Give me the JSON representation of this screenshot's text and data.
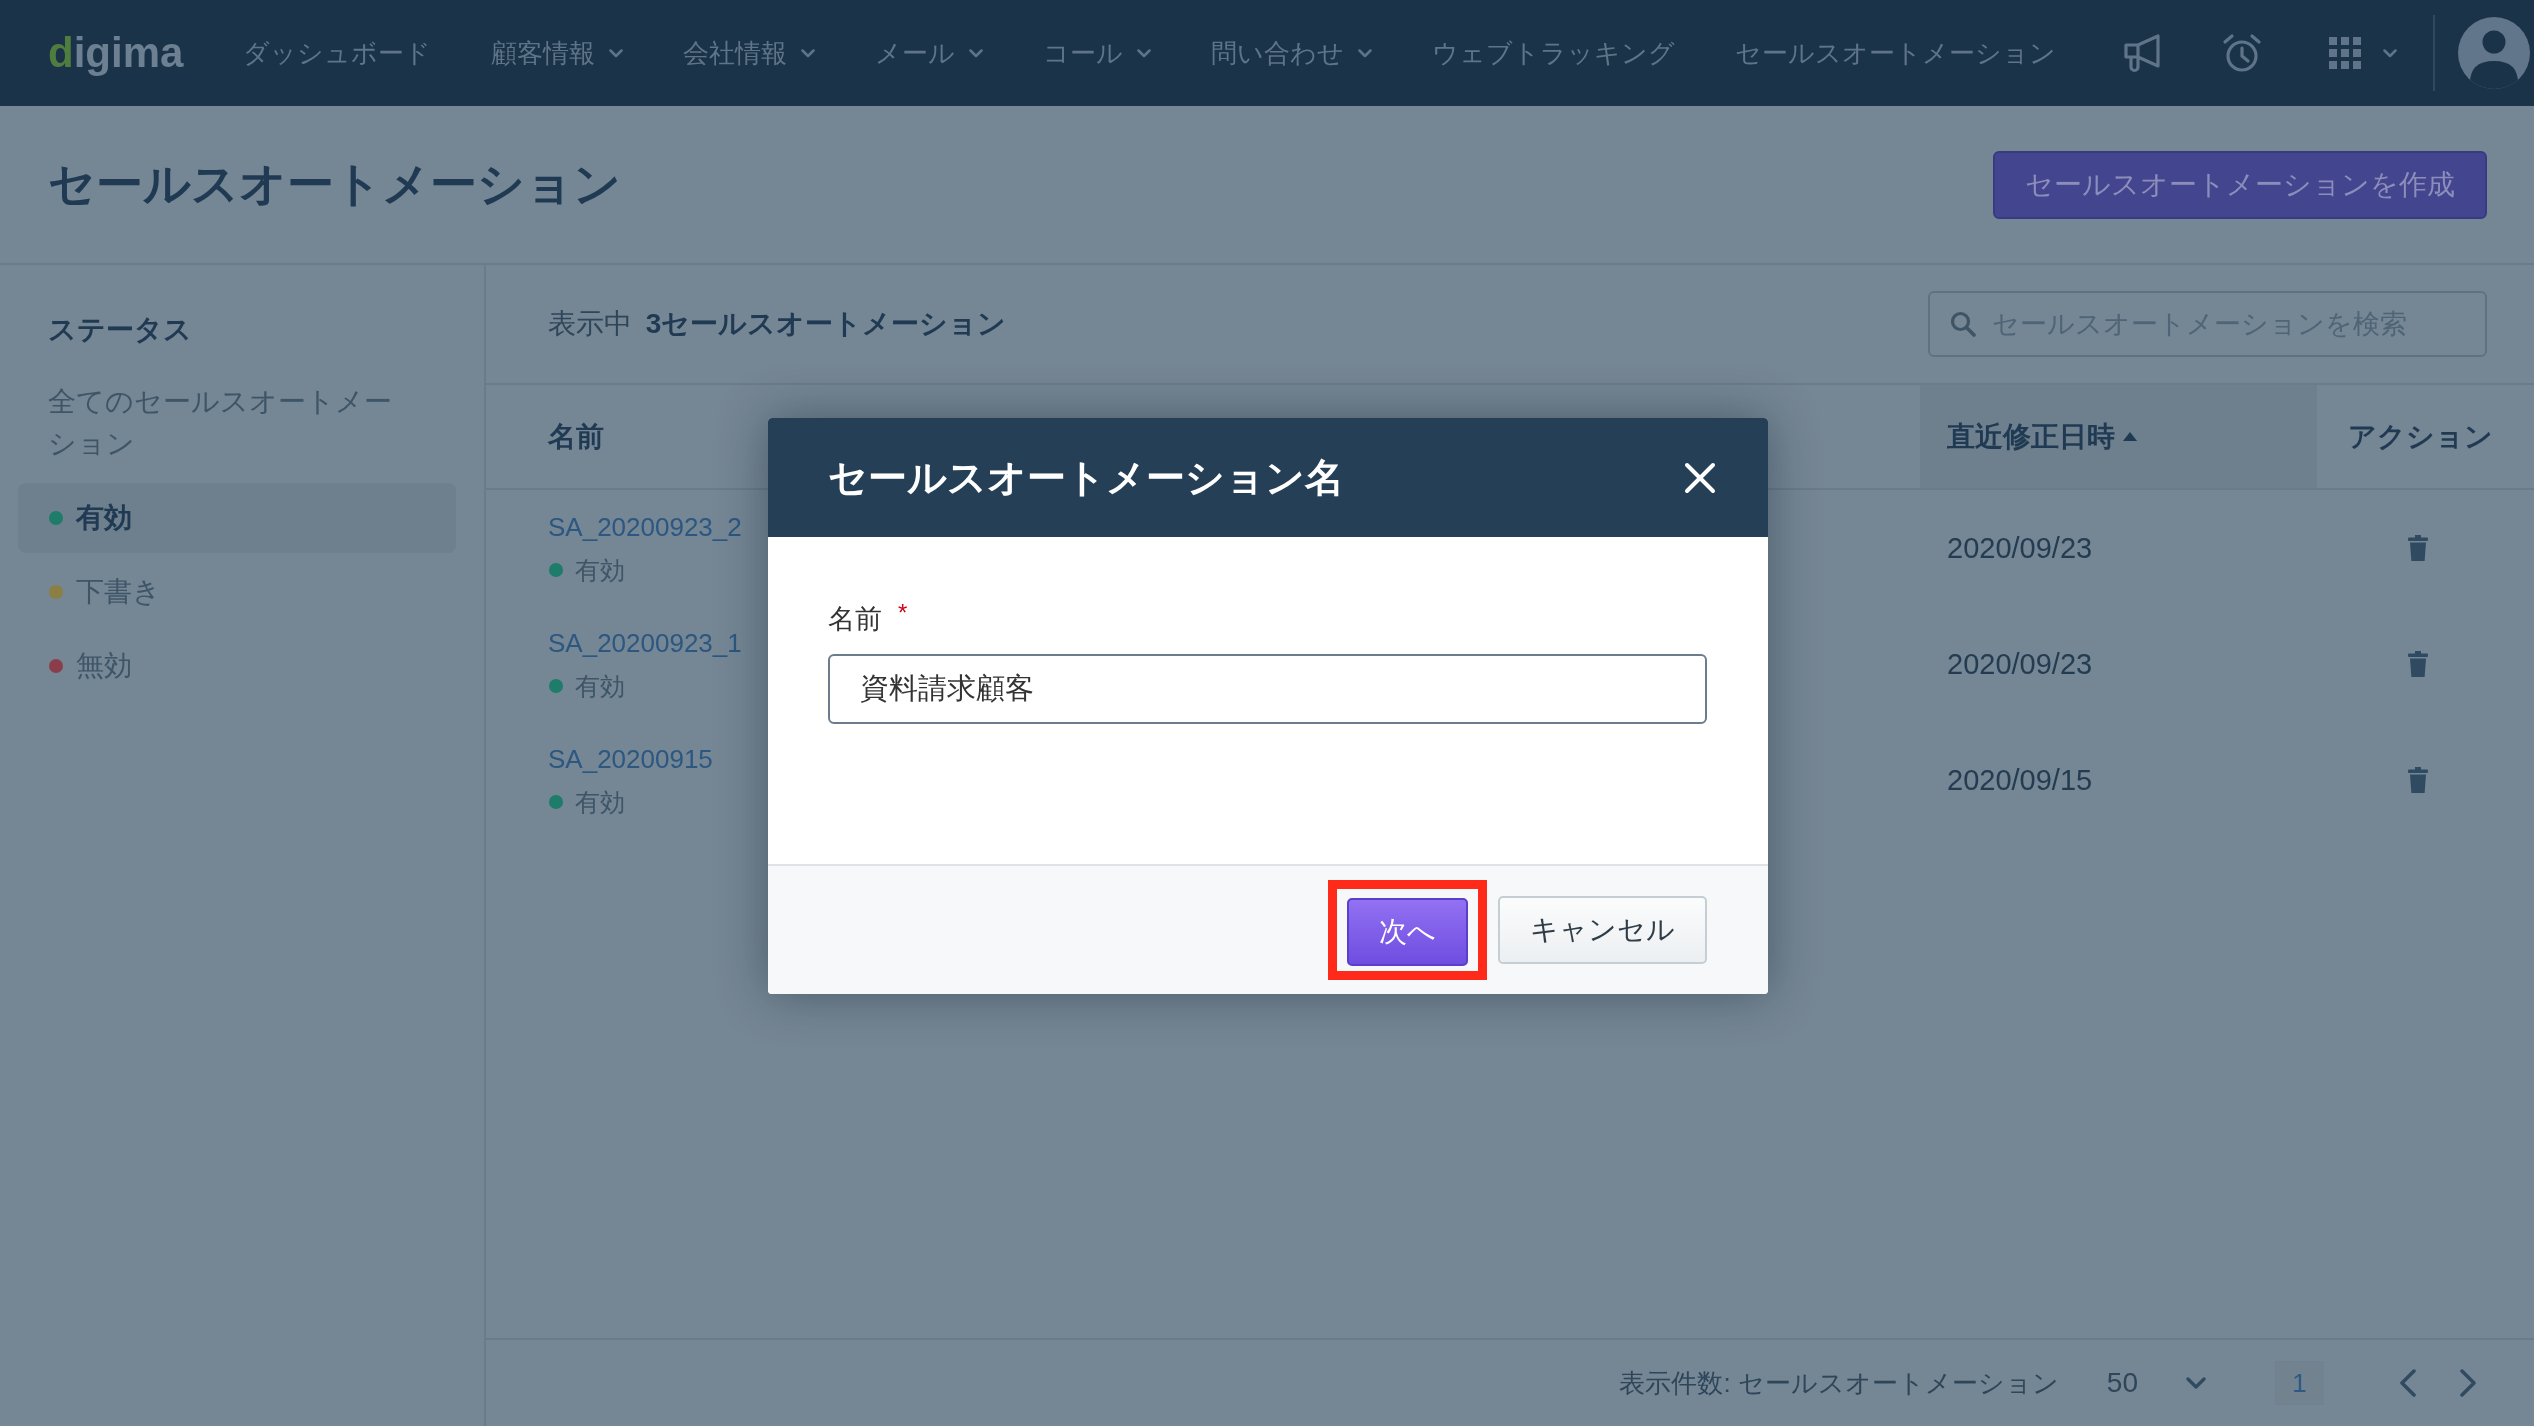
{
  "nav": {
    "logo": "digima",
    "items": [
      {
        "label": "ダッシュボード",
        "dropdown": false,
        "selected": false
      },
      {
        "label": "顧客情報",
        "dropdown": true,
        "selected": false
      },
      {
        "label": "会社情報",
        "dropdown": true,
        "selected": false
      },
      {
        "label": "メール",
        "dropdown": true,
        "selected": false
      },
      {
        "label": "コール",
        "dropdown": true,
        "selected": false
      },
      {
        "label": "問い合わせ",
        "dropdown": true,
        "selected": false
      },
      {
        "label": "ウェブトラッキング",
        "dropdown": false,
        "selected": false
      },
      {
        "label": "セールスオートメーション",
        "dropdown": false,
        "selected": false
      }
    ]
  },
  "page_header": {
    "title": "セールスオートメーション",
    "create_button": "セールスオートメーションを作成"
  },
  "sidebar": {
    "heading": "ステータス",
    "items": [
      {
        "label": "全てのセールスオートメーション",
        "selected": false
      },
      {
        "label": "有効",
        "selected": true,
        "color": "#1e7c6b"
      },
      {
        "label": "下書き",
        "selected": false,
        "color": "#8b7f44"
      },
      {
        "label": "無効",
        "selected": false,
        "color": "#8c3d4b"
      }
    ]
  },
  "toolbar": {
    "summary": "表示中 **3セールスオートメーション**",
    "search": {
      "placeholder": "セールスオートメーションを検索"
    }
  },
  "table": {
    "columns": [
      {
        "label": "名前",
        "sorted": false
      },
      {
        "label": "直近修正日時",
        "sorted": true
      },
      {
        "label": "アクション",
        "sorted": false
      }
    ],
    "rows": [
      {
        "name": "SA_20200923_2",
        "status": "有効",
        "color": "#1e7c6b",
        "date": "2020/09/23"
      },
      {
        "name": "SA_20200923_1",
        "status": "有効",
        "color": "#1e7c6b",
        "date": "2020/09/23"
      },
      {
        "name": "SA_20200915",
        "status": "有効",
        "color": "#1e7c6b",
        "date": "2020/09/15"
      }
    ]
  },
  "pagination": {
    "label": "表示件数: セールスオートメーション",
    "per_page": "50",
    "pages": [
      {
        "label": "1",
        "selected": true
      }
    ]
  },
  "modal": {
    "title": "セールスオートメーション名",
    "field": {
      "label": "名前",
      "required_mark": "*",
      "value": "資料請求顧客"
    },
    "buttons": [
      {
        "label": "次へ",
        "kind": "primary",
        "highlighted": true
      },
      {
        "label": "キャンセル",
        "kind": "secondary",
        "highlighted": false
      }
    ]
  }
}
